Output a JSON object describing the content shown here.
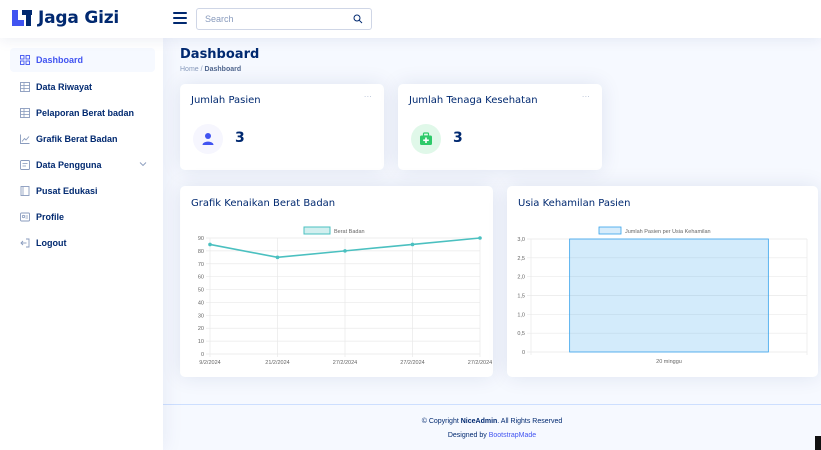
{
  "app": {
    "name": "Jaga Gizi"
  },
  "header": {
    "search_placeholder": "Search"
  },
  "sidebar": {
    "items": [
      {
        "label": "Dashboard",
        "icon": "grid-icon",
        "active": true
      },
      {
        "label": "Data Riwayat",
        "icon": "table-icon"
      },
      {
        "label": "Pelaporan Berat badan",
        "icon": "table-icon"
      },
      {
        "label": "Grafik Berat Badan",
        "icon": "chart-icon"
      },
      {
        "label": "Data Pengguna",
        "icon": "form-icon",
        "has_chevron": true
      },
      {
        "label": "Pusat Edukasi",
        "icon": "book-icon"
      },
      {
        "label": "Profile",
        "icon": "id-icon"
      },
      {
        "label": "Logout",
        "icon": "logout-icon"
      }
    ]
  },
  "page": {
    "title": "Dashboard",
    "breadcrumb": {
      "home": "Home",
      "separator": "/",
      "current": "Dashboard"
    }
  },
  "cards": {
    "pasien": {
      "title": "Jumlah Pasien",
      "value": "3",
      "dots": "...",
      "icon": "person-icon",
      "accent": "#4154f1",
      "bg": "#f6f6fe"
    },
    "tenaga": {
      "title": "Jumlah Tenaga Kesehatan",
      "value": "3",
      "dots": "...",
      "icon": "medkit-icon",
      "accent": "#2eca6a",
      "bg": "#e0f8e9"
    }
  },
  "charts": {
    "berat": {
      "title": "Grafik Kenaikan Berat Badan"
    },
    "usia": {
      "title": "Usia Kehamilan Pasien"
    }
  },
  "chart_data": [
    {
      "type": "line",
      "title": "Grafik Kenaikan Berat Badan",
      "categories": [
        "9/2/2024",
        "21/2/2024",
        "27/2/2024",
        "27/2/2024",
        "27/2/2024"
      ],
      "series": [
        {
          "name": "Berat Badan",
          "values": [
            85,
            75,
            80,
            85,
            90
          ]
        }
      ],
      "ylim": [
        0,
        90
      ],
      "yticks": [
        0,
        10,
        20,
        30,
        40,
        50,
        60,
        70,
        80,
        90
      ],
      "color": "#4bc0c0",
      "grid": true,
      "legend": "top"
    },
    {
      "type": "bar",
      "title": "Usia Kehamilan Pasien",
      "categories": [
        "20 minggu"
      ],
      "series": [
        {
          "name": "Jumlah Pasien per Usia Kehamilan",
          "values": [
            3
          ]
        }
      ],
      "ylim": [
        0,
        3
      ],
      "yticks": [
        "0",
        "0,5",
        "1,0",
        "1,5",
        "2,0",
        "2,5",
        "3,0"
      ],
      "color": "#36a2eb",
      "grid": true,
      "legend": "top"
    }
  ],
  "footer": {
    "copyright_prefix": "© Copyright",
    "brand": "NiceAdmin",
    "rights": ". All Rights Reserved",
    "designed_prefix": "Designed by",
    "designer": "BootstrapMade"
  }
}
